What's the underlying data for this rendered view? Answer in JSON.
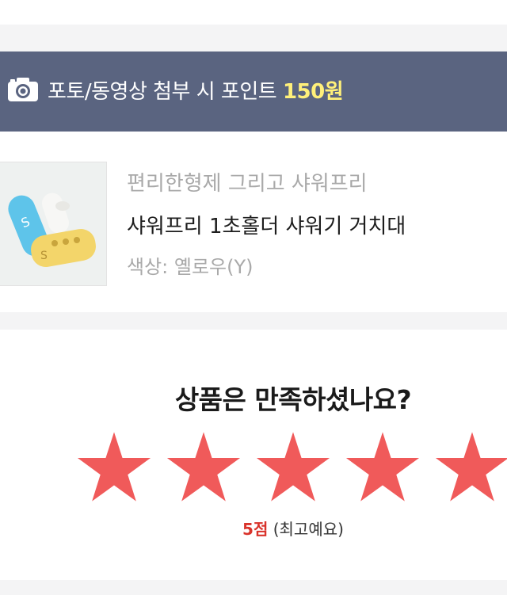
{
  "banner": {
    "text": "포토/동영상 첨부 시 포인트 ",
    "points": "150원",
    "icon": "camera-icon"
  },
  "product": {
    "brand": "편리한형제 그리고 샤워프리",
    "name": "샤워프리 1초홀더 샤워기 거치대",
    "option": "색상: 옐로우(Y)"
  },
  "rating": {
    "question": "상품은 만족하셨나요?",
    "stars_filled": 5,
    "stars_total": 5,
    "score": "5점",
    "score_label": " (최고예요)",
    "star_color": "#f05a5a",
    "accent_color": "#d9332b"
  },
  "colors": {
    "banner_bg": "#5a6480",
    "banner_highlight": "#fff07a"
  }
}
